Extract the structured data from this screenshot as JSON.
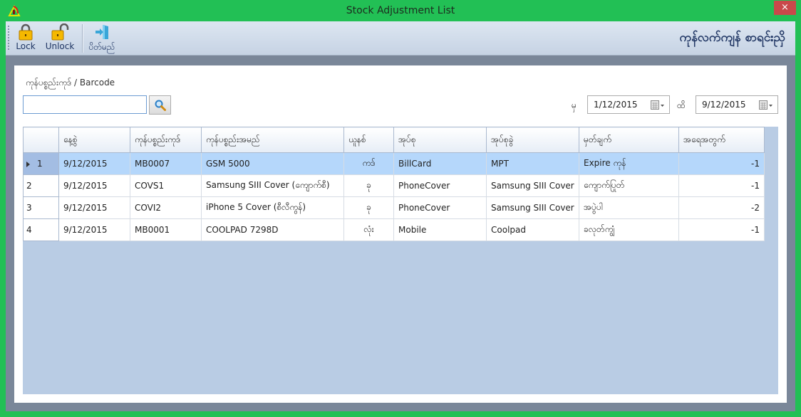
{
  "window": {
    "title": "Stock Adjustment List",
    "close_label": "×"
  },
  "toolbar": {
    "lock_label": "Lock",
    "unlock_label": "Unlock",
    "exit_label": "ပိတ်မည်",
    "brand_title": "ကုန်လက်ကျန် စာရင်းညှိ"
  },
  "filter": {
    "label": "ကုန်ပစ္စည်းကုဒ် / Barcode",
    "search_value": "",
    "from_label": "မှ",
    "from_date": "1/12/2015",
    "to_label": "ထိ",
    "to_date": "9/12/2015"
  },
  "grid": {
    "columns": [
      "",
      "နေ့စွဲ",
      "ကုန်ပစ္စည်းကုဒ်",
      "ကုန်ပစ္စည်းအမည်",
      "ယူနစ်",
      "အုပ်စု",
      "အုပ်စုခွဲ",
      "မှတ်ချက်",
      "အရေအတွက်"
    ],
    "rows": [
      {
        "num": "1",
        "date": "9/12/2015",
        "code": "MB0007",
        "name": "GSM 5000",
        "unit": "ကဒ်",
        "group": "BillCard",
        "subgroup": "MPT",
        "remark": "Expire ကုန်",
        "qty": "-1",
        "selected": true
      },
      {
        "num": "2",
        "date": "9/12/2015",
        "code": "COVS1",
        "name": "Samsung SIII Cover (ကျောက်စီ)",
        "unit": "ခု",
        "group": "PhoneCover",
        "subgroup": "Samsung SIII Cover",
        "remark": "ကျောက်ပြုတ်",
        "qty": "-1",
        "selected": false
      },
      {
        "num": "3",
        "date": "9/12/2015",
        "code": "COVI2",
        "name": "iPhone 5 Cover (စီလီကွန်)",
        "unit": "ခု",
        "group": "PhoneCover",
        "subgroup": "Samsung SIII Cover",
        "remark": "အပွဲပါ",
        "qty": "-2",
        "selected": false
      },
      {
        "num": "4",
        "date": "9/12/2015",
        "code": "MB0001",
        "name": "COOLPAD 7298D",
        "unit": "လုံး",
        "group": "Mobile",
        "subgroup": "Coolpad",
        "remark": "ခလုတ်ကျွံ",
        "qty": "-1",
        "selected": false
      }
    ]
  },
  "colors": {
    "title_bar": "#22c055",
    "close_button": "#c9494a",
    "selected_row": "#b5d7fb",
    "grid_background": "#b9cce4"
  }
}
